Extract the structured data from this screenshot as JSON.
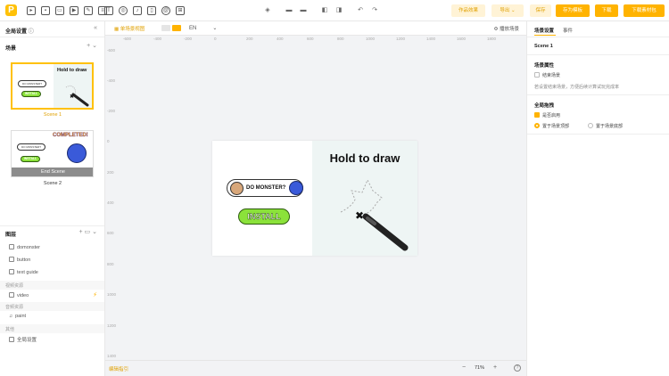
{
  "toolbar": {
    "logo": "P",
    "tool_icons": [
      "pointer-icon",
      "image-icon",
      "frame-icon",
      "video-tool-icon",
      "edit-tool-icon",
      "sequence-icon",
      "text-tool-icon",
      "shape-tool-icon",
      "audio-tool-icon",
      "document-tool-icon",
      "at-sign-icon",
      "grid-tool-icon"
    ],
    "preview_label": "作品效果",
    "export_label": "导出",
    "save_label": "保存",
    "save_as_template_label": "存为模板",
    "download_label": "下载",
    "download_all_label": "下载素材包"
  },
  "left": {
    "global_settings": "全局设置",
    "scenes_title": "场景",
    "scenes": [
      {
        "label": "Scene 1",
        "banner_text": "Hold to draw",
        "monster_text": "DO MONSTER?",
        "install_text": "INSTALL"
      },
      {
        "label": "Scene 2",
        "overlay": "End Scene",
        "monster_text": "DO MONSTER?",
        "install_text": "INSTALL",
        "headline": "COMPLETED!"
      }
    ],
    "layers_title": "图层",
    "layers": [
      {
        "label": "domonster",
        "icon": "image-icon"
      },
      {
        "label": "button",
        "icon": "image-icon"
      },
      {
        "label": "text guide",
        "icon": "text-icon"
      }
    ],
    "group_video": "视频资源",
    "video_layer": "video",
    "group_audio": "音频资源",
    "audio_layer": "paint",
    "group_other": "其他",
    "settings_layer": "全局设置"
  },
  "canvas": {
    "single_view_label": "单场景视图",
    "language": "EN",
    "play_scene_label": "播放场景",
    "ruler_h": [
      "-600",
      "-400",
      "-200",
      "0",
      "200",
      "400",
      "600",
      "800",
      "1000",
      "1200",
      "1400",
      "1600",
      "1800"
    ],
    "ruler_v": [
      "-600",
      "-400",
      "-200",
      "0",
      "200",
      "400",
      "600",
      "800",
      "1000",
      "1200",
      "1400"
    ],
    "stage": {
      "headline": "Hold to draw",
      "monster_text": "DO MONSTER?",
      "install_text": "INSTALL"
    },
    "bottom": {
      "link": "编辑指引",
      "zoom": "71%",
      "minus": "−",
      "plus": "+",
      "help": "?"
    }
  },
  "right": {
    "tab_scene": "场景设置",
    "tab_event": "事件",
    "scene_name": "Scene 1",
    "props_title": "场景属性",
    "end_scene_label": "结束场景",
    "end_scene_desc": "若设置结束场景，方便后续计算试玩完成率",
    "global_drag_title": "全局拖拽",
    "enable_label": "是否启用",
    "option_top": "置于场景顶部",
    "option_bottom": "置于场景底部"
  },
  "colors": {
    "accent": "#ffb300",
    "accent_light": "#fff3d6",
    "install_green": "#8be23a"
  }
}
